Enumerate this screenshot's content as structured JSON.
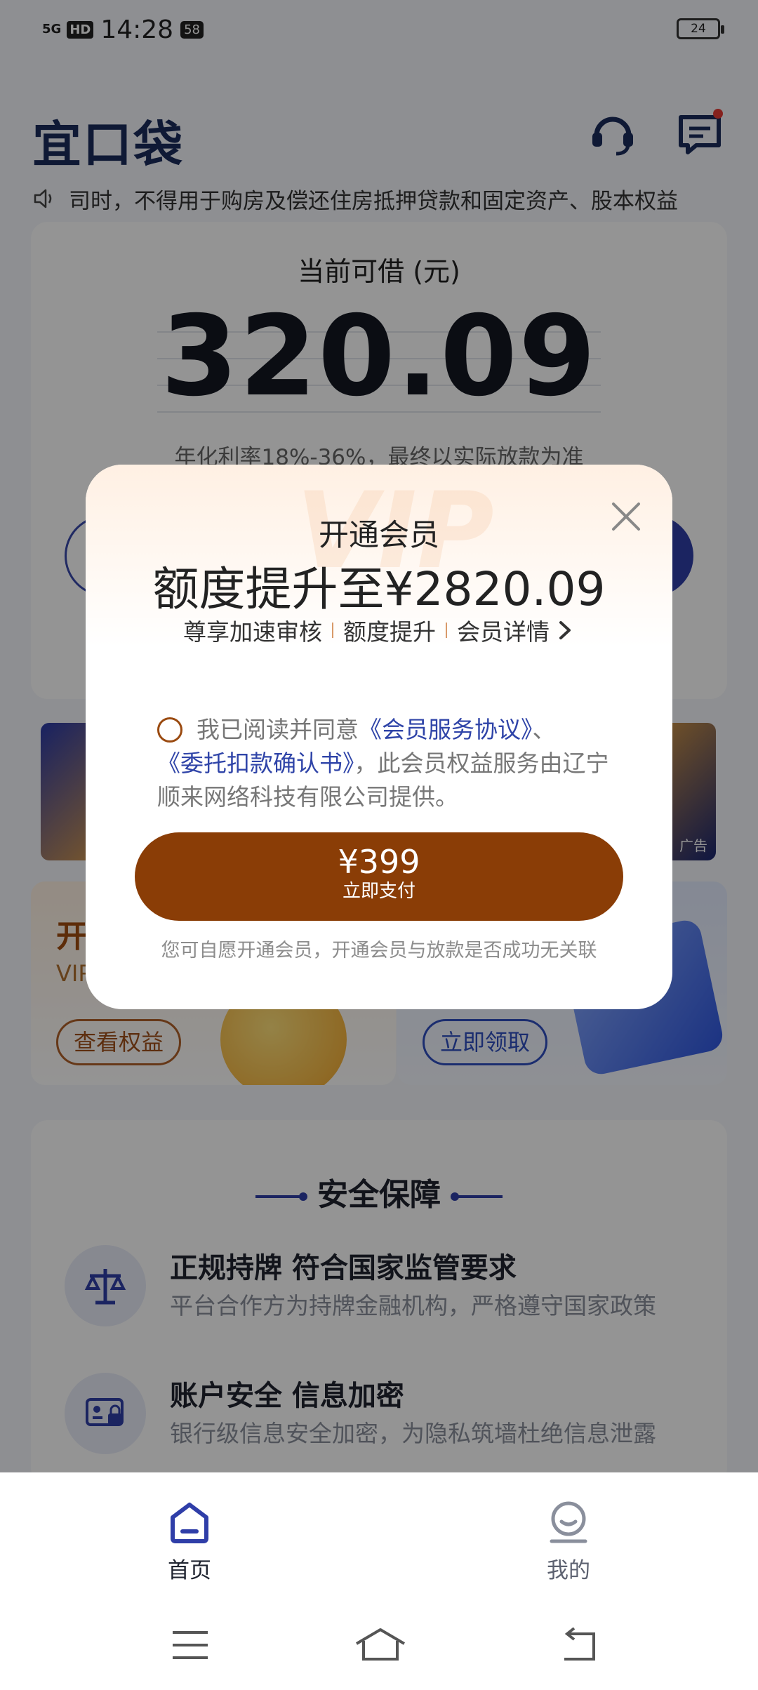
{
  "status_bar": {
    "network": "5G",
    "hd": "HD",
    "time": "14:28",
    "badge": "58",
    "battery": "24"
  },
  "header": {
    "logo": "宜口袋"
  },
  "notice": {
    "text": "司时，不得用于购房及偿还住房抵押贷款和固定资产、股本权益"
  },
  "loan_card": {
    "label": "当前可借 (元)",
    "amount": "320.09",
    "rate_note": "年化利率18%-36%，最终以实际放款为准"
  },
  "banner": {
    "ad_label": "广告"
  },
  "promo": {
    "left_title": "开",
    "left_sub": "VIP",
    "left_button": "查看权益",
    "right_button": "立即领取"
  },
  "safety": {
    "title": "安全保障",
    "items": [
      {
        "title": "正规持牌 符合国家监管要求",
        "desc": "平台合作方为持牌金融机构，严格遵守国家政策"
      },
      {
        "title": "账户安全 信息加密",
        "desc": "银行级信息安全加密，为隐私筑墙杜绝信息泄露"
      }
    ]
  },
  "tabbar": {
    "home": "首页",
    "mine": "我的"
  },
  "modal": {
    "watermark": "VIP",
    "title": "开通会员",
    "headline": "额度提升至¥2820.09",
    "benefit_1": "尊享加速审核",
    "benefit_2": "额度提升",
    "benefit_3": "会员详情",
    "agree_prefix": "我已阅读并同意",
    "doc_1": "《会员服务协议》",
    "sep": "、",
    "doc_2": "《委托扣款确认书》",
    "agree_suffix": "，此会员权益服务由辽宁顺来网络科技有限公司提供。",
    "pay_price": "¥399",
    "pay_label": "立即支付",
    "disclaimer": "您可自愿开通会员，开通会员与放款是否成功无关联"
  },
  "colors": {
    "brand_blue": "#2f3ea8",
    "pay_button": "#8a3d06",
    "link_blue": "#2f44a8"
  }
}
